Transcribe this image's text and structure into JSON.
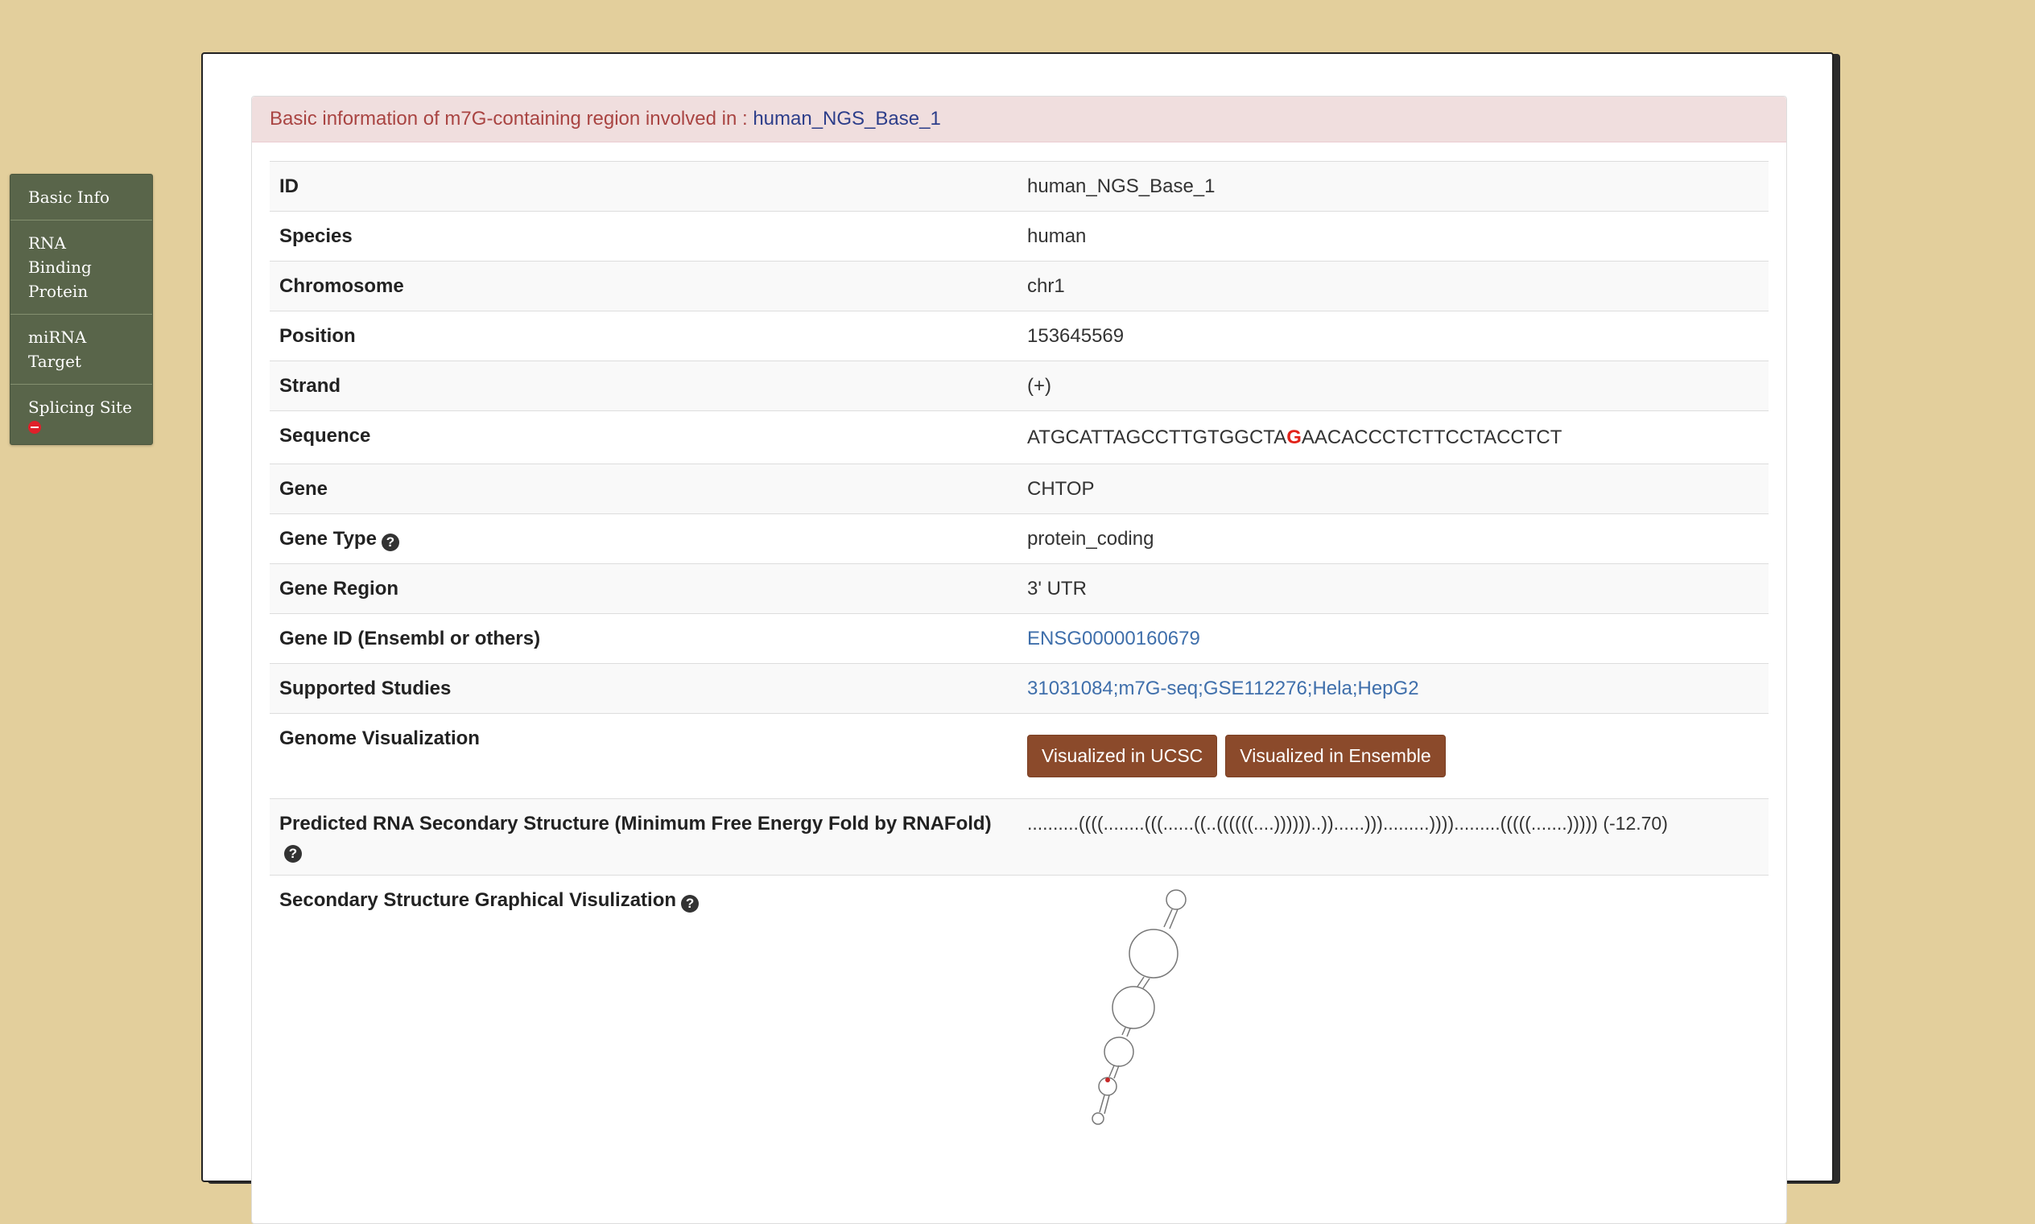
{
  "sidenav": {
    "items": [
      {
        "label": "Basic Info"
      },
      {
        "label": "RNA Binding Protein"
      },
      {
        "label": "miRNA Target"
      },
      {
        "label": "Splicing Site"
      }
    ]
  },
  "panel": {
    "heading_prefix": "Basic information of m7G-containing region involved in : ",
    "heading_entry": "human_NGS_Base_1"
  },
  "rows": {
    "id": {
      "label": "ID",
      "value": "human_NGS_Base_1"
    },
    "species": {
      "label": "Species",
      "value": "human"
    },
    "chromosome": {
      "label": "Chromosome",
      "value": "chr1"
    },
    "position": {
      "label": "Position",
      "value": "153645569"
    },
    "strand": {
      "label": "Strand",
      "value": "(+)"
    },
    "sequence": {
      "label": "Sequence",
      "before": "ATGCATTAGCCTTGTGGCTA",
      "site": "G",
      "after": "AACACCCTCTTCCTACCTCT"
    },
    "gene": {
      "label": "Gene",
      "value": "CHTOP"
    },
    "gene_type": {
      "label": "Gene Type",
      "value": "protein_coding"
    },
    "gene_region": {
      "label": "Gene Region",
      "value": "3' UTR"
    },
    "gene_id": {
      "label": "Gene ID (Ensembl or others)",
      "value": "ENSG00000160679"
    },
    "studies": {
      "label": "Supported Studies",
      "value": "31031084;m7G-seq;GSE112276;Hela;HepG2"
    },
    "genome_vis": {
      "label": "Genome Visualization",
      "ucsc_button": "Visualized in UCSC",
      "ensemble_button": "Visualized in Ensemble"
    },
    "secondary": {
      "label": "Predicted RNA Secondary Structure (Minimum Free Energy Fold by RNAFold)",
      "value": "..........((((........(((......((..((((((....))))))..))......))).........)))).........(((((.......))))) (-12.70)"
    },
    "graphical": {
      "label": "Secondary Structure Graphical Visulization"
    }
  },
  "colors": {
    "background": "#e3cf9c",
    "nav": "#59654a",
    "button": "#8b4a2b",
    "highlight": "#e2231a",
    "link": "#3f6fab"
  },
  "icons": {
    "help": "question-circle",
    "splicing_status": "minus-circle"
  }
}
